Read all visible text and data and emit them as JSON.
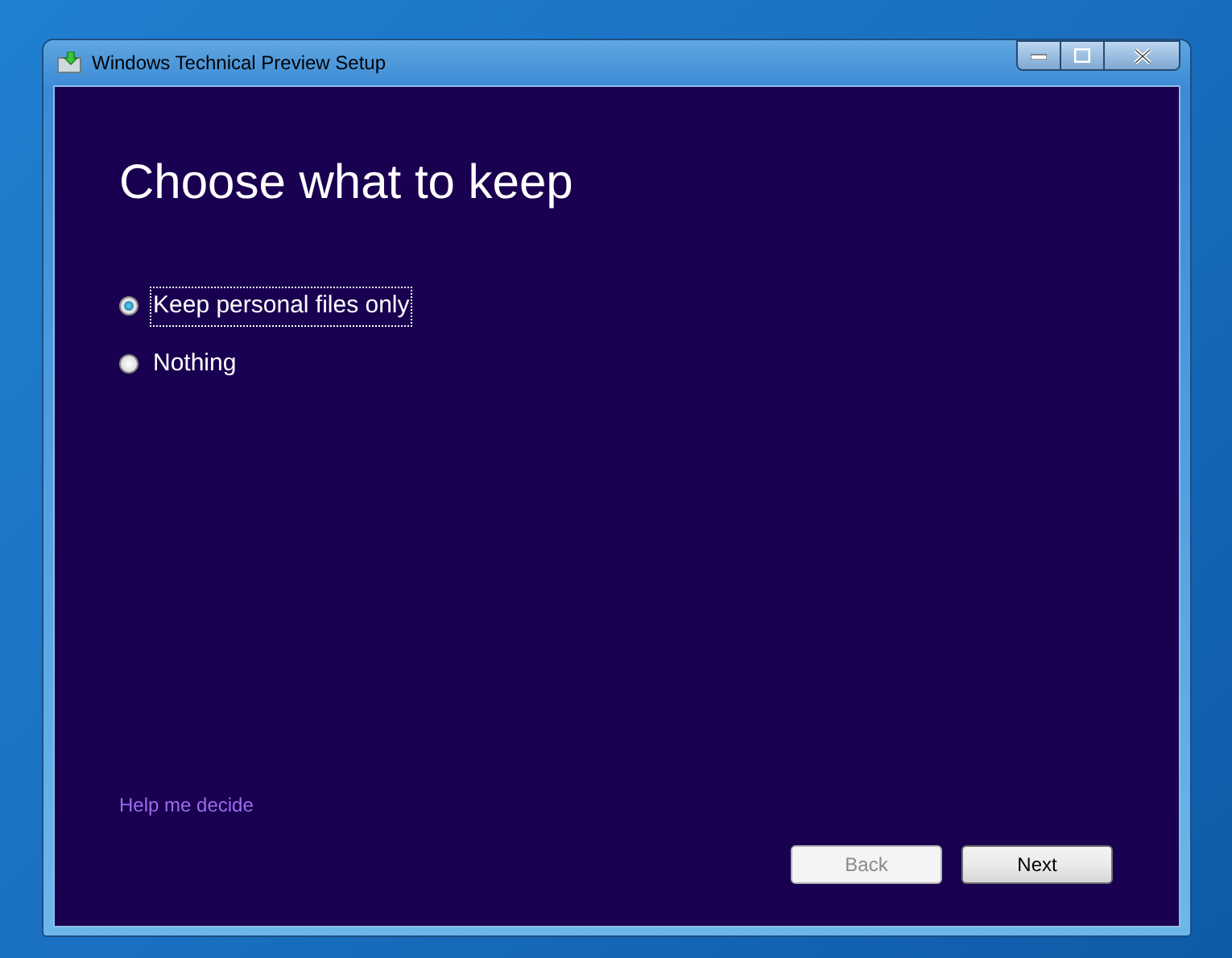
{
  "window": {
    "title": "Windows Technical Preview Setup"
  },
  "heading": "Choose what to keep",
  "options": [
    {
      "label": "Keep personal files only",
      "selected": true
    },
    {
      "label": "Nothing",
      "selected": false
    }
  ],
  "help_link": "Help me decide",
  "buttons": [
    {
      "label": "Back",
      "disabled": true
    },
    {
      "label": "Next",
      "disabled": false
    }
  ]
}
